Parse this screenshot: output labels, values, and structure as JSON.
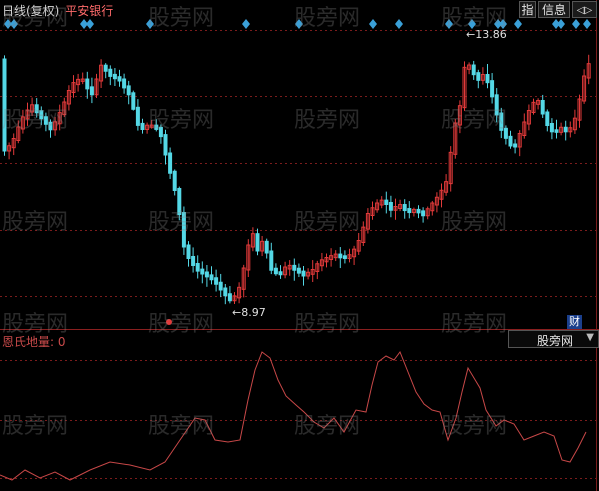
{
  "header": {
    "title": "日线(复权)",
    "stock_name": "平安银行",
    "btn_indicator": "指",
    "btn_info": "信息",
    "btn_nav": "◁▷"
  },
  "price_chart": {
    "high_label": "←13.86",
    "low_label": "←8.97",
    "cai_badge": "财",
    "candle_up_color": "#e23a3a",
    "candle_down_color": "#54d8e6",
    "marker_color": "#3aa0d8"
  },
  "indicator": {
    "title": "恩氏地量: 0",
    "selector_value": "股旁网",
    "line_color": "#c84848"
  },
  "watermark_text": "股旁网"
}
